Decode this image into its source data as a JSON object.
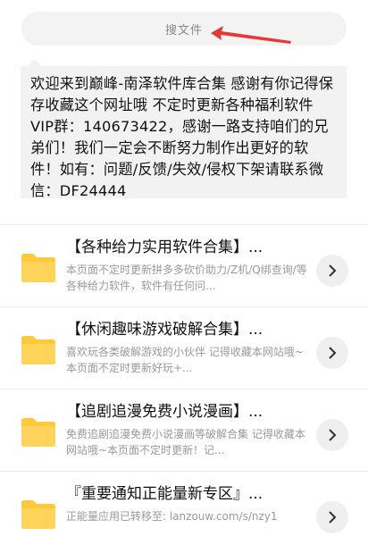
{
  "search": {
    "placeholder": "搜文件"
  },
  "notice": {
    "text": "欢迎来到巅峰-南泽软件库合集 感谢有你记得保存收藏这个网址哦 不定时更新各种福利软件 VIP群：140673422，感谢一路支持咱们的兄弟们！我们一定会不断努力制作出更好的软件！如有：问题/反馈/失效/侵权下架请联系微信：DF24444"
  },
  "list": [
    {
      "title": "【各种给力实用软件合集】...",
      "desc": "本页面不定时更新拼多多砍价助力/Z机/Q绑查询/等各种给力软件，软件有任何问..."
    },
    {
      "title": "【休闲趣味游戏破解合集】...",
      "desc": "喜欢玩各类破解游戏的小伙伴 记得收藏本网站哦~本页面不定时更新好玩+..."
    },
    {
      "title": "【追剧追漫免费小说漫画】...",
      "desc": "免费追剧追漫免费小说漫画等破解合集 记得收藏本网站哦~本页面不定时更新！记..."
    },
    {
      "title": "『重要通知正能量新专区』...",
      "desc": "正能量应用已转移至: lanzouw.com/s/nzy1"
    }
  ],
  "colors": {
    "folder": "#ffc93c",
    "arrow": "#e53935"
  }
}
